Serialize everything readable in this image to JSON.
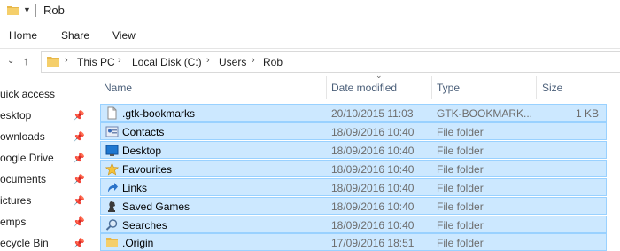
{
  "window": {
    "title": "Rob"
  },
  "ribbon": {
    "tabs": [
      "Home",
      "Share",
      "View"
    ]
  },
  "address": {
    "crumbs": [
      "This PC",
      "Local Disk (C:)",
      "Users",
      "Rob"
    ]
  },
  "nav_pane": [
    {
      "label": "uick access",
      "pinned": false
    },
    {
      "label": "esktop",
      "pinned": true
    },
    {
      "label": "ownloads",
      "pinned": true
    },
    {
      "label": "oogle Drive",
      "pinned": true
    },
    {
      "label": "ocuments",
      "pinned": true
    },
    {
      "label": "ictures",
      "pinned": true
    },
    {
      "label": "emps",
      "pinned": true
    },
    {
      "label": "ecycle Bin",
      "pinned": true
    }
  ],
  "columns": {
    "name": "Name",
    "date": "Date modified",
    "type": "Type",
    "size": "Size"
  },
  "files": [
    {
      "icon": "document-icon",
      "name": ".gtk-bookmarks",
      "date": "20/10/2015 11:03",
      "type": "GTK-BOOKMARK...",
      "size": "1 KB"
    },
    {
      "icon": "contacts-icon",
      "name": "Contacts",
      "date": "18/09/2016 10:40",
      "type": "File folder",
      "size": ""
    },
    {
      "icon": "desktop-icon",
      "name": "Desktop",
      "date": "18/09/2016 10:40",
      "type": "File folder",
      "size": ""
    },
    {
      "icon": "star-icon",
      "name": "Favourites",
      "date": "18/09/2016 10:40",
      "type": "File folder",
      "size": ""
    },
    {
      "icon": "link-arrow-icon",
      "name": "Links",
      "date": "18/09/2016 10:40",
      "type": "File folder",
      "size": ""
    },
    {
      "icon": "chess-piece-icon",
      "name": "Saved Games",
      "date": "18/09/2016 10:40",
      "type": "File folder",
      "size": ""
    },
    {
      "icon": "magnifier-icon",
      "name": "Searches",
      "date": "18/09/2016 10:40",
      "type": "File folder",
      "size": ""
    },
    {
      "icon": "folder-icon",
      "name": ".Origin",
      "date": "17/09/2016 18:51",
      "type": "File folder",
      "size": ""
    }
  ]
}
